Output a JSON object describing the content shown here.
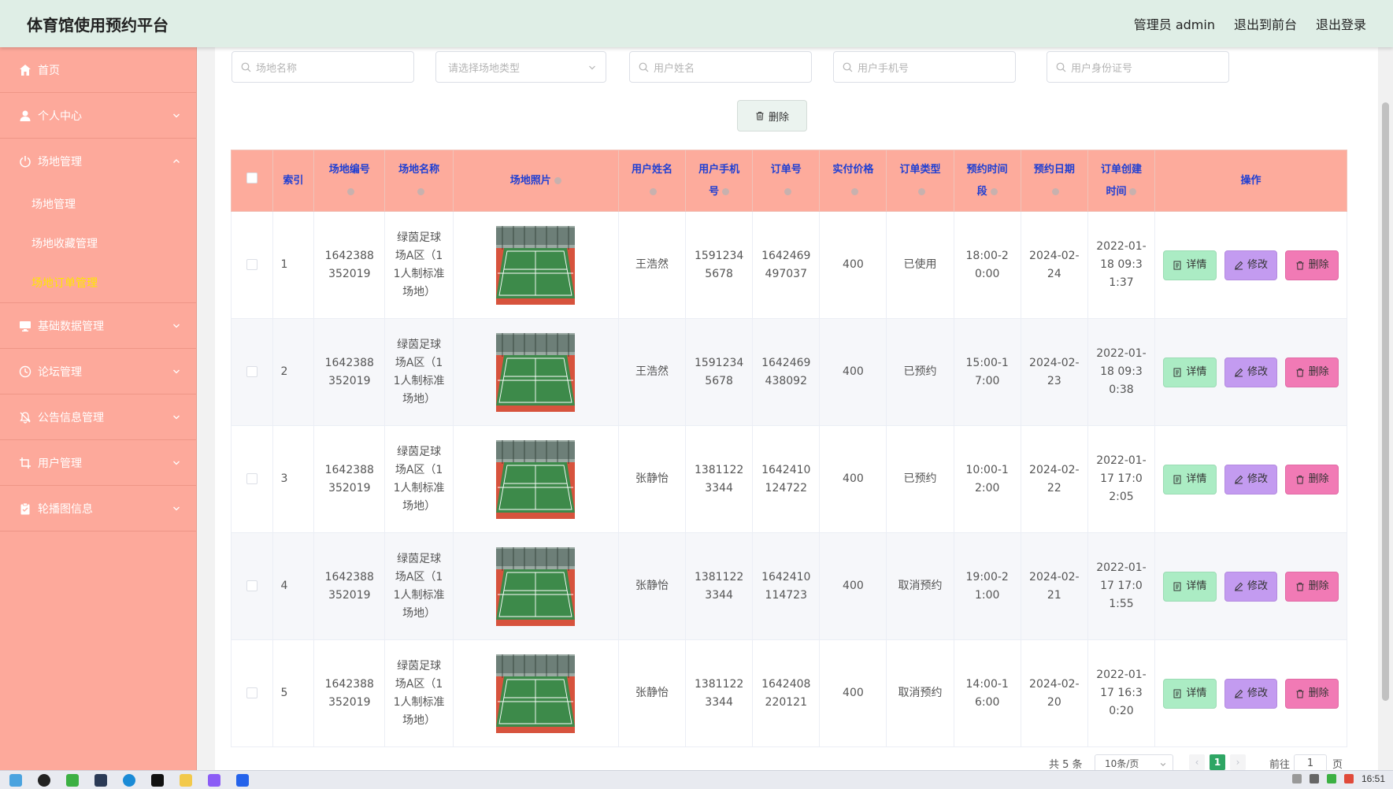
{
  "header": {
    "title": "体育馆使用预约平台",
    "admin_label": "管理员 admin",
    "to_front": "退出到前台",
    "logout": "退出登录"
  },
  "sidebar": {
    "items": [
      {
        "label": "首页",
        "icon": "home-icon"
      },
      {
        "label": "个人中心",
        "icon": "user-icon"
      },
      {
        "label": "场地管理",
        "icon": "power-icon"
      },
      {
        "label": "基础数据管理",
        "icon": "monitor-icon"
      },
      {
        "label": "论坛管理",
        "icon": "clock-icon"
      },
      {
        "label": "公告信息管理",
        "icon": "bell-off-icon"
      },
      {
        "label": "用户管理",
        "icon": "crop-icon"
      },
      {
        "label": "轮播图信息",
        "icon": "clipboard-icon"
      }
    ],
    "sub_items": [
      "场地管理",
      "场地收藏管理",
      "场地订单管理"
    ]
  },
  "search": {
    "venue_name": "场地名称",
    "venue_type": "请选择场地类型",
    "user_name": "用户姓名",
    "user_phone": "用户手机号",
    "user_id": "用户身份证号"
  },
  "toolbar": {
    "delete_label": "删除"
  },
  "table": {
    "headers": [
      "索引",
      "场地编号",
      "场地名称",
      "场地照片",
      "用户姓名",
      "用户手机号",
      "订单号",
      "实付价格",
      "订单类型",
      "预约时间段",
      "预约日期",
      "订单创建时间",
      "操作"
    ],
    "rows": [
      {
        "index": "1",
        "venue_no": "1642388352019",
        "venue_name": "绿茵足球场A区（11人制标准场地）",
        "user_name": "王浩然",
        "phone": "15912345678",
        "order_no": "1642469497037",
        "price": "400",
        "order_type": "已使用",
        "time_slot": "18:00-20:00",
        "date": "2024-02-24",
        "created": "2022-01-18 09:31:37"
      },
      {
        "index": "2",
        "venue_no": "1642388352019",
        "venue_name": "绿茵足球场A区（11人制标准场地）",
        "user_name": "王浩然",
        "phone": "15912345678",
        "order_no": "1642469438092",
        "price": "400",
        "order_type": "已预约",
        "time_slot": "15:00-17:00",
        "date": "2024-02-23",
        "created": "2022-01-18 09:30:38"
      },
      {
        "index": "3",
        "venue_no": "1642388352019",
        "venue_name": "绿茵足球场A区（11人制标准场地）",
        "user_name": "张静怡",
        "phone": "13811223344",
        "order_no": "1642410124722",
        "price": "400",
        "order_type": "已预约",
        "time_slot": "10:00-12:00",
        "date": "2024-02-22",
        "created": "2022-01-17 17:02:05"
      },
      {
        "index": "4",
        "venue_no": "1642388352019",
        "venue_name": "绿茵足球场A区（11人制标准场地）",
        "user_name": "张静怡",
        "phone": "13811223344",
        "order_no": "1642410114723",
        "price": "400",
        "order_type": "取消预约",
        "time_slot": "19:00-21:00",
        "date": "2024-02-21",
        "created": "2022-01-17 17:01:55"
      },
      {
        "index": "5",
        "venue_no": "1642388352019",
        "venue_name": "绿茵足球场A区（11人制标准场地）",
        "user_name": "张静怡",
        "phone": "13811223344",
        "order_no": "1642408220121",
        "price": "400",
        "order_type": "取消预约",
        "time_slot": "14:00-16:00",
        "date": "2024-02-20",
        "created": "2022-01-17 16:30:20"
      }
    ],
    "actions": {
      "detail": "详情",
      "edit": "修改",
      "delete": "删除"
    }
  },
  "pagination": {
    "total": "共 5 条",
    "page_size": "10条/页",
    "current": "1",
    "goto_prefix": "前往",
    "goto_value": "1",
    "goto_suffix": "页"
  },
  "taskbar": {
    "time": "16:51"
  },
  "colors": {
    "header_bg": "#dfeee6",
    "sidebar_bg": "#fda99b",
    "table_header_bg": "#fdab9c",
    "table_header_text": "#1f3fd3",
    "active_sub": "#ffe600",
    "detail_btn": "#abecc4",
    "edit_btn": "#c39bf0",
    "delete_btn": "#f17ab5"
  }
}
